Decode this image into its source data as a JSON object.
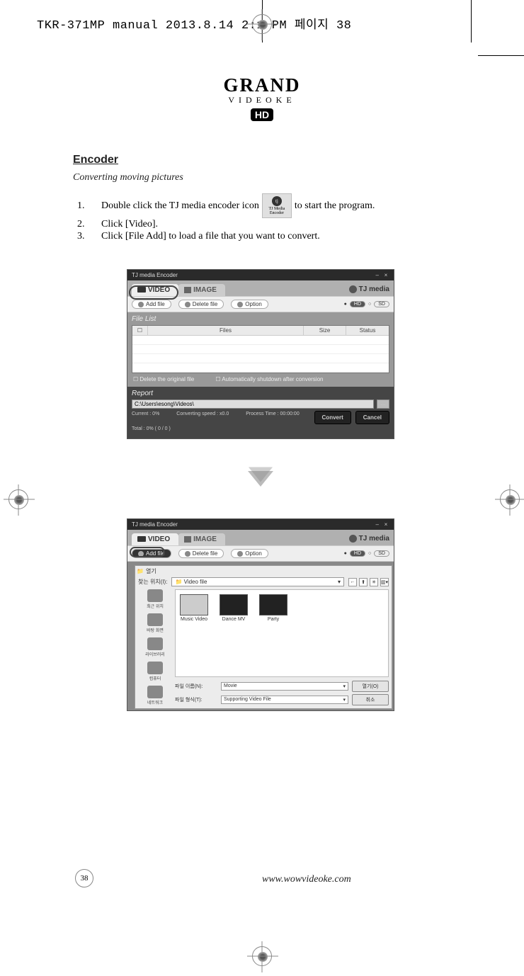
{
  "header_stamp": "TKR-371MP manual  2013.8.14  2:1 PM  페이지 38",
  "logo": {
    "brand": "GRAND",
    "sub": "VIDEOKE",
    "hd": "HD"
  },
  "section": {
    "title": "Encoder",
    "subtitle": "Converting moving pictures"
  },
  "steps": {
    "n1": "1.",
    "t1a": "Double click the TJ media encoder icon",
    "t1b": "to start the program.",
    "icon_line1": "TJ Media",
    "icon_line2": "Encoder",
    "n2": "2.",
    "t2": "Click [Video].",
    "n3": "3.",
    "t3": "Click [File Add] to load a file that you want to convert."
  },
  "ss1": {
    "title": "TJ media Encoder",
    "tab_video": "VIDEO",
    "tab_image": "IMAGE",
    "brand": "TJ media",
    "btn_add": "Add file",
    "btn_del": "Delete file",
    "btn_opt": "Option",
    "qual_hd": "HD",
    "qual_sd": "SD",
    "filelist_label": "File List",
    "col_files": "Files",
    "col_size": "Size",
    "col_status": "Status",
    "chk_delete": "Delete the original file",
    "chk_shutdown": "Automatically shutdown after conversion",
    "report_label": "Report",
    "path": "C:\\Users\\esong\\Videos\\",
    "stat_current": "Current : 0%",
    "stat_speed": "Converting speed : x0.0",
    "stat_time": "Process Time : 00:00:00",
    "btn_convert": "Convert",
    "btn_cancel": "Cancel",
    "total": "Total : 0%    ( 0 / 0 )"
  },
  "ss2": {
    "title": "TJ media Encoder",
    "tab_video": "VIDEO",
    "tab_image": "IMAGE",
    "brand": "TJ media",
    "btn_add": "Add file",
    "btn_del": "Delete file",
    "btn_opt": "Option",
    "qual_hd": "HD",
    "qual_sd": "SD",
    "dlg_title": "열기",
    "look_in": "찾는 위치(I):",
    "folder": "Video file",
    "side_recent": "최근 위치",
    "side_desktop": "바탕 화면",
    "side_library": "라이브러리",
    "side_computer": "컴퓨터",
    "side_network": "네트워크",
    "file_music": "Music Video",
    "file_dance": "Dance MV",
    "file_party": "Party",
    "label_name": "파일 이름(N):",
    "label_type": "파일 형식(T):",
    "val_name": "Movie",
    "val_type": "Supporting Video File",
    "btn_open": "열기(O)",
    "btn_cancel": "취소"
  },
  "page_num": "38",
  "footer_url": "www.wowvideoke.com"
}
